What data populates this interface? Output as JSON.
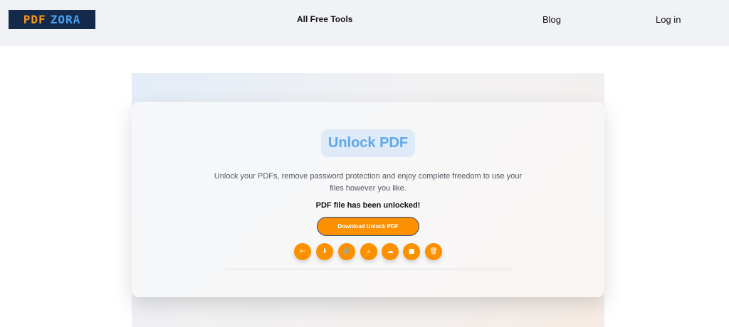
{
  "brand": {
    "logo_left": "PDF",
    "logo_right": "ZORA"
  },
  "nav": {
    "tools": "All Free Tools",
    "blog": "Blog",
    "login": "Log in"
  },
  "tool": {
    "title": "Unlock PDF",
    "description": "Unlock your PDFs, remove password protection and enjoy complete freedom to use your files however you like.",
    "status": "PDF file has been unlocked!",
    "download_label": "Download Unlock PDF"
  },
  "actions": [
    {
      "name": "back",
      "glyph": "←"
    },
    {
      "name": "download",
      "glyph": "⬇"
    },
    {
      "name": "link",
      "glyph": "🔗"
    },
    {
      "name": "google-drive",
      "glyph": "▵"
    },
    {
      "name": "cloud",
      "glyph": "☁"
    },
    {
      "name": "dropbox",
      "glyph": "■"
    },
    {
      "name": "delete",
      "glyph": "🗑"
    }
  ],
  "colors": {
    "accent": "#fb9100",
    "brand_bg": "#15294a",
    "title": "#5fa8e6"
  }
}
